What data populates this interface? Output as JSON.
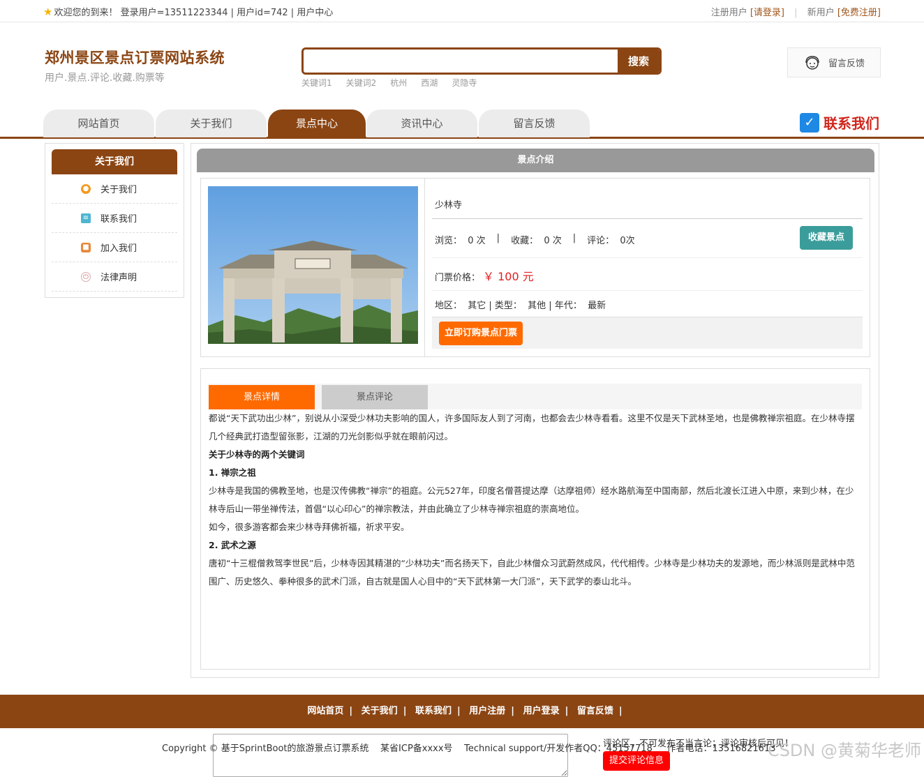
{
  "topbar": {
    "welcome": "欢迎您的到来！ 登录用户=13511223344 | 用户id=742 | 用户中心",
    "reg_label": "注册用户",
    "login_link": "[请登录]",
    "new_label": "新用户",
    "register_link": "[免费注册]"
  },
  "brand": {
    "title": "郑州景区景点订票网站系统",
    "subtitle": "用户.景点.评论.收藏.购票等"
  },
  "search": {
    "value": "",
    "button": "搜索"
  },
  "keywords": [
    "关键词1",
    "关键词2",
    "杭州",
    "西湖",
    "灵隐寺"
  ],
  "feedback": {
    "label": "留言反馈"
  },
  "nav": {
    "tabs": [
      "网站首页",
      "关于我们",
      "景点中心",
      "资讯中心",
      "留言反馈"
    ],
    "active": "景点中心"
  },
  "contact": {
    "label": "联系我们"
  },
  "sidebar": {
    "head": "关于我们",
    "items": [
      "关于我们",
      "联系我们",
      "加入我们",
      "法律声明"
    ]
  },
  "main": {
    "header": "景点介绍"
  },
  "attraction": {
    "name": "少林寺",
    "views": "浏览：  0 次",
    "favs": "收藏：  0 次",
    "comments": "评论：  0次",
    "collect_button": "收藏景点",
    "price_label": "门票价格：",
    "price_value": "￥ 100 元",
    "attrs": "地区：  其它 | 类型：  其他 | 年代：  最新",
    "buy_button": "立即订购景点门票"
  },
  "detail": {
    "tab_detail": "景点详情",
    "tab_comments": "景点评论",
    "para1": "都说“天下武功出少林”，别说从小深受少林功夫影响的国人，许多国际友人到了河南，也都会去少林寺看看。这里不仅是天下武林圣地，也是佛教禅宗祖庭。在少林寺摆几个经典武打造型留张影，江湖的刀光剑影似乎就在眼前闪过。",
    "h1": "关于少林寺的两个关键词",
    "h2": "1. 禅宗之祖",
    "para2": "少林寺是我国的佛教圣地，也是汉传佛教“禅宗”的祖庭。公元527年，印度名僧菩提达摩（达摩祖师）经水路航海至中国南部，然后北渡长江进入中原，来到少林，在少林寺后山一带坐禅传法，首倡“以心印心”的禅宗教法，并由此确立了少林寺禅宗祖庭的崇高地位。",
    "para3": "如今，很多游客都会来少林寺拜佛祈福，祈求平安。",
    "h3": "2. 武术之源",
    "para4": "唐初“十三棍僧救驾李世民”后，少林寺因其精湛的“少林功夫”而名扬天下，自此少林僧众习武蔚然成风，代代相传。少林寺是少林功夫的发源地，而少林派则是武林中范围广、历史悠久、拳种很多的武术门派，自古就是国人心目中的“天下武林第一大门派”，天下武学的泰山北斗。",
    "comment_hint": "评论区，不可发布不当言论；评论审核后可见！",
    "submit_button": "提交评论信息"
  },
  "footer": {
    "links": [
      "网站首页",
      "关于我们",
      "联系我们",
      "用户注册",
      "用户登录",
      "留言反馈"
    ]
  },
  "copyright": "Copyright © 基于SprintBoot的旅游景点订票系统    某省ICP备xxxx号    Technical support/开发作者QQ：45157718     作者电话：13516821613",
  "watermark": "CSDN @黄菊华老师"
}
